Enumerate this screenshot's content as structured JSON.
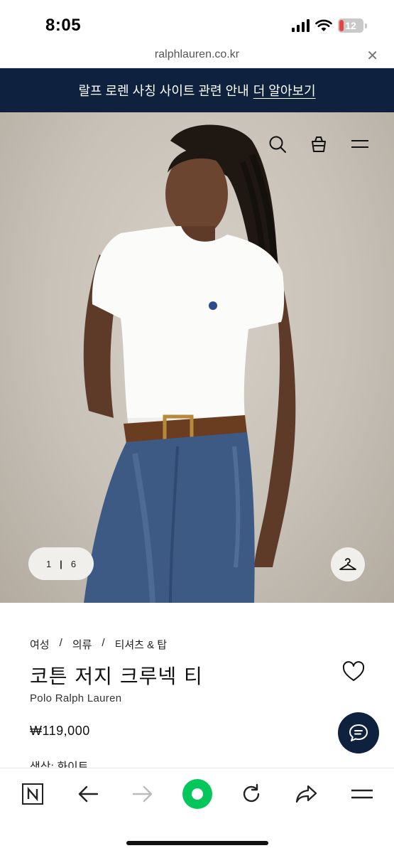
{
  "status": {
    "time": "8:05",
    "battery": "12"
  },
  "url_bar": {
    "domain": "ralphlauren.co.kr"
  },
  "banner": {
    "text": "랄프 로렌 사칭 사이트 관련 안내",
    "link": "더 알아보기"
  },
  "hero": {
    "current_image": "1",
    "separator": "|",
    "total_images": "6"
  },
  "product": {
    "breadcrumb": [
      "여성",
      "/",
      "의류",
      "/",
      "티셔츠 & 탑"
    ],
    "title": "코튼 저지 크루넥 티",
    "brand": "Polo Ralph Lauren",
    "price": "₩119,000",
    "color_label": "색상: 화이트"
  },
  "icons": {
    "header": [
      "search-icon",
      "shopping-bag-icon",
      "menu-icon"
    ],
    "toolbar": [
      "naver-n-icon",
      "back-arrow-icon",
      "forward-arrow-icon",
      "green-dot-icon",
      "refresh-icon",
      "share-icon",
      "menu-icon"
    ]
  },
  "colors": {
    "navy": "#0e2240",
    "accent_green": "#03c75a",
    "battery_low": "#e64545"
  }
}
